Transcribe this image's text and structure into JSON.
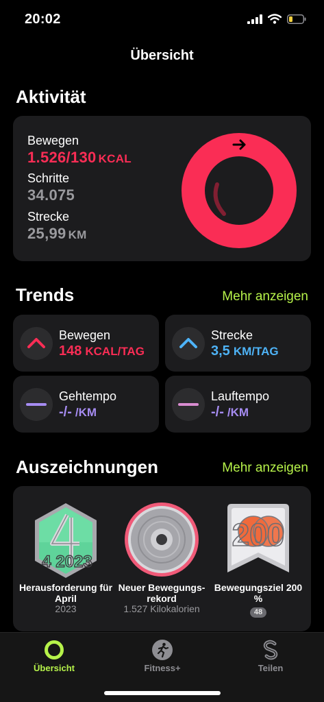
{
  "status": {
    "time": "20:02"
  },
  "nav": {
    "title": "Übersicht"
  },
  "activity": {
    "section_title": "Aktivität",
    "move": {
      "label": "Bewegen",
      "value": "1.526/130",
      "unit": "KCAL"
    },
    "steps": {
      "label": "Schritte",
      "value": "34.075"
    },
    "distance": {
      "label": "Strecke",
      "value": "25,99",
      "unit": "KM"
    },
    "ring_color": "#fa2d55",
    "move_goal_fraction": 11.74
  },
  "trends": {
    "section_title": "Trends",
    "more_label": "Mehr anzeigen",
    "items": [
      {
        "label": "Bewegen",
        "value": "148",
        "unit": "KCAL/TAG",
        "color": "#fa2d55",
        "direction": "up"
      },
      {
        "label": "Strecke",
        "value": "3,5",
        "unit": "KM/TAG",
        "color": "#4eb3f7",
        "direction": "up"
      },
      {
        "label": "Gehtempo",
        "value": "-/-",
        "unit": "/KM",
        "color": "#a68cf2",
        "direction": "flat"
      },
      {
        "label": "Lauftempo",
        "value": "-/-",
        "unit": "/KM",
        "color": "#a68cf2",
        "direction": "flat"
      }
    ]
  },
  "awards": {
    "section_title": "Auszeichnungen",
    "more_label": "Mehr anzeigen",
    "items": [
      {
        "title": "Herausforderung für April",
        "subtitle": "2023",
        "badge_text": "4 2023"
      },
      {
        "title": "Neuer Bewegungs-rekord",
        "subtitle": "1.527 Kilokalorien"
      },
      {
        "title": "Bewegungsziel 200 %",
        "count": "48",
        "badge_text": "200"
      }
    ]
  },
  "tabs": [
    {
      "label": "Übersicht",
      "active": true,
      "color": "#b6f24a"
    },
    {
      "label": "Fitness+",
      "active": false,
      "color": "#8e8e93"
    },
    {
      "label": "Teilen",
      "active": false,
      "color": "#8e8e93"
    }
  ]
}
